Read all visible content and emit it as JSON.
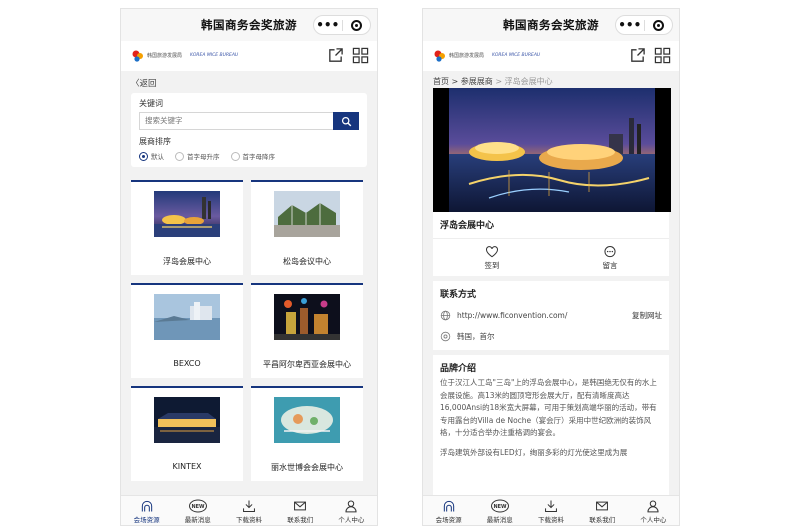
{
  "app_title": "韩国商务会奖旅游",
  "capsule": {
    "more": "•••"
  },
  "logo": {
    "text_cn": "韩国旅游发展局",
    "text_en": "KOREA MICE BUREAU"
  },
  "colors": {
    "brand": "#16357e"
  },
  "list_page": {
    "back_label": "〈返回",
    "keyword_label": "关键词",
    "search_placeholder": "搜索关键字",
    "sort_label": "展商排序",
    "sort_options": [
      "默认",
      "首字母升序",
      "首字母降序"
    ],
    "sort_selected": "默认",
    "venues": [
      "浮岛会展中心",
      "松岛会议中心",
      "BEXCO",
      "平昌阿尔卑西亚会展中心",
      "KINTEX",
      "丽水世博会会展中心"
    ]
  },
  "detail_page": {
    "breadcrumb": {
      "home": "首页",
      "sep1": " > ",
      "mid": "参展展商",
      "sep2": " > ",
      "current": "浮岛会展中心"
    },
    "venue_name": "浮岛会展中心",
    "actions": {
      "checkin": "签到",
      "message": "留言"
    },
    "contact_title": "联系方式",
    "website": "http://www.ficonvention.com/",
    "copy_label": "复制网址",
    "location": "韩国，首尔",
    "brand_title": "品牌介绍",
    "intro_p1": "位于汉江人工岛\"三岛\"上的浮岛会展中心，是韩国绝无仅有的水上会展设施。高13米的圆顶穹形会展大厅，配有清晰度高达16,000Ansi的18米宽大屏幕，可用于策划高端华丽的活动，带有专用露台的Villa de Noche（宴会厅）采用中世纪欧洲的装饰风格，十分适合举办注重格调的宴会。",
    "intro_p2": "浮岛建筑外部设有LED灯，绚丽多彩的灯光使这里成为展"
  },
  "tabbar": [
    "会场资源",
    "最新消息",
    "下载资料",
    "联系我们",
    "个人中心"
  ],
  "icons": {
    "new_badge": "NEW"
  }
}
